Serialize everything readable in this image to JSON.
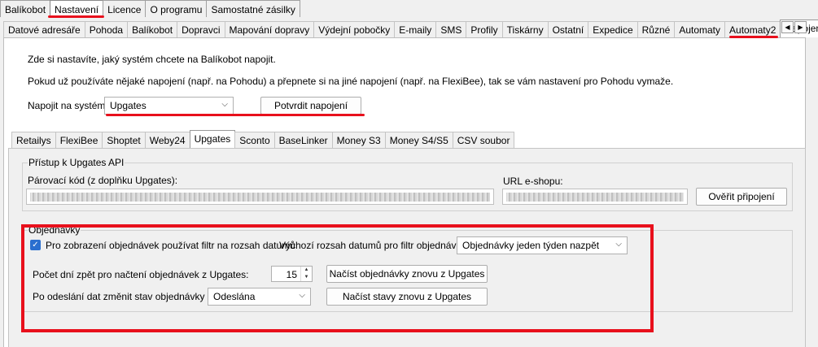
{
  "main_tabs": [
    "Balíkobot",
    "Nastavení",
    "Licence",
    "O programu",
    "Samostatné zásilky"
  ],
  "settings_tabs": [
    "Datové adresáře",
    "Pohoda",
    "Balíkobot",
    "Dopravci",
    "Mapování dopravy",
    "Výdejní pobočky",
    "E-maily",
    "SMS",
    "Profily",
    "Tiskárny",
    "Ostatní",
    "Expedice",
    "Různé",
    "Automaty",
    "Automaty2",
    "Napojení"
  ],
  "scroll": {
    "left": "◀",
    "right": "▶"
  },
  "napojeni": {
    "intro1": "Zde si nastavíte, jaký systém chcete na Balíkobot napojit.",
    "intro2": "Pokud už používáte nějaké napojení (např. na Pohodu) a přepnete si na jiné napojení (např. na FlexiBee), tak se vám nastavení pro Pohodu vymaže.",
    "system_label": "Napojit na systém:",
    "system_value": "Upgates",
    "confirm_button": "Potvrdit napojení"
  },
  "system_tabs": [
    "Retailys",
    "FlexiBee",
    "Shoptet",
    "Weby24",
    "Upgates",
    "Sconto",
    "BaseLinker",
    "Money S3",
    "Money S4/S5",
    "CSV soubor"
  ],
  "api": {
    "legend": "Přístup k Upgates API",
    "pair_label": "Párovací kód (z doplňku Upgates):",
    "url_label": "URL e-shopu:",
    "verify_button": "Ověřit připojení"
  },
  "orders": {
    "legend": "Objednávky",
    "filter_checkbox_label": "Pro zobrazení objednávek používat filtr na rozsah datumů",
    "filter_checked": true,
    "range_label": "Výchozí rozsah datumů pro filtr objednávek:",
    "range_value": "Objednávky jeden týden nazpět",
    "days_label": "Počet dní zpět pro načtení objednávek z Upgates:",
    "days_value": "15",
    "reload_orders_button": "Načíst objednávky znovu z Upgates",
    "status_label": "Po odeslání dat změnit stav objednávky na:",
    "status_value": "Odeslána",
    "reload_status_button": "Načíst stavy znovu z Upgates"
  },
  "icons": {
    "checkmark": "✓",
    "chevron": "⌵",
    "spin_up": "▲",
    "spin_down": "▼"
  },
  "colors": {
    "highlight": "#e8101c",
    "checkbox": "#2b6fcf"
  }
}
